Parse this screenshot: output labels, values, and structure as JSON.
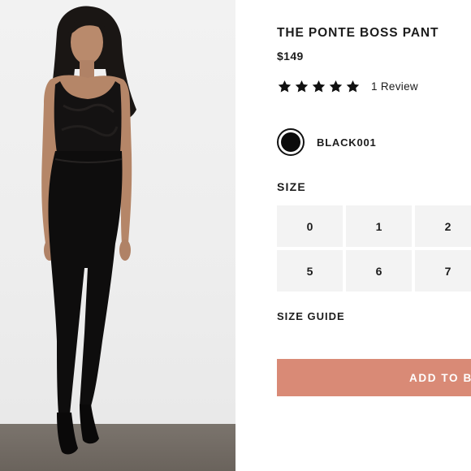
{
  "product": {
    "title": "THE PONTE BOSS PANT",
    "price": "$149",
    "rating": {
      "stars": 5,
      "max": 5,
      "review_label": "1 Review"
    },
    "color": {
      "name": "BLACK001",
      "swatch": "#0b0b0b"
    }
  },
  "size": {
    "heading": "SIZE",
    "options": [
      "0",
      "1",
      "2",
      "5",
      "6",
      "7"
    ],
    "guide_label": "SIZE GUIDE"
  },
  "cart": {
    "add_label": "ADD TO B"
  },
  "colors": {
    "accent": "#d98a76",
    "size_bg": "#f3f3f3",
    "text": "#1c1c1c"
  },
  "image": {
    "subject": "product-photo"
  }
}
